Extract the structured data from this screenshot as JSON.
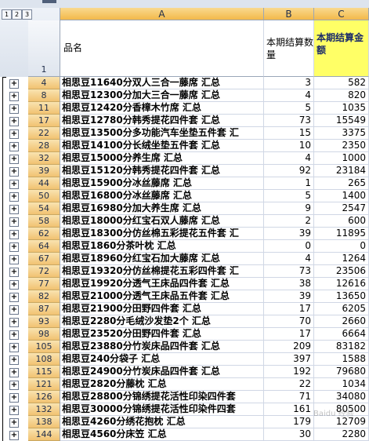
{
  "outline_levels": [
    "1",
    "2",
    "3"
  ],
  "columns": [
    "A",
    "B",
    "C"
  ],
  "header_row_number": "1",
  "header": {
    "name": "品名",
    "qty": "本期结算数量",
    "amount": "本期结算金额"
  },
  "rows": [
    {
      "num": "4",
      "name": "相思豆11640分双人三合一藤席 汇总",
      "qty": "3",
      "amount": "582"
    },
    {
      "num": "8",
      "name": "相思豆12300分加大三合一藤席 汇总",
      "qty": "4",
      "amount": "820"
    },
    {
      "num": "11",
      "name": "相思豆12420分香樟木竹席 汇总",
      "qty": "5",
      "amount": "1035"
    },
    {
      "num": "17",
      "name": "相思豆12780分韩秀提花四件套 汇总",
      "qty": "73",
      "amount": "15549"
    },
    {
      "num": "22",
      "name": "相思豆13500分多功能汽车坐垫五件套 汇",
      "qty": "15",
      "amount": "3375"
    },
    {
      "num": "28",
      "name": "相思豆14100分长绒坐垫五件套 汇总",
      "qty": "10",
      "amount": "2350"
    },
    {
      "num": "32",
      "name": "相思豆15000分养生席 汇总",
      "qty": "4",
      "amount": "1000"
    },
    {
      "num": "39",
      "name": "相思豆15120分韩秀提花四件套 汇总",
      "qty": "92",
      "amount": "23184"
    },
    {
      "num": "44",
      "name": "相思豆15900分冰丝藤席 汇总",
      "qty": "1",
      "amount": "265"
    },
    {
      "num": "50",
      "name": "相思豆16800分冰丝藤席 汇总",
      "qty": "5",
      "amount": "1400"
    },
    {
      "num": "54",
      "name": "相思豆16980分加大养生席 汇总",
      "qty": "9",
      "amount": "2547"
    },
    {
      "num": "58",
      "name": "相思豆18000分红宝石双人藤席 汇总",
      "qty": "2",
      "amount": "600"
    },
    {
      "num": "62",
      "name": "相思豆18300分仿丝棉五彩提花五件套 汇",
      "qty": "39",
      "amount": "11895"
    },
    {
      "num": "64",
      "name": "相思豆1860分茶叶枕 汇总",
      "qty": "0",
      "amount": "0"
    },
    {
      "num": "67",
      "name": "相思豆18960分红宝石加大藤席 汇总",
      "qty": "4",
      "amount": "1264"
    },
    {
      "num": "72",
      "name": "相思豆19320分仿丝棉提花五彩四件套 汇",
      "qty": "73",
      "amount": "23506"
    },
    {
      "num": "77",
      "name": "相思豆19920分透气王床品四件套 汇总",
      "qty": "38",
      "amount": "12616"
    },
    {
      "num": "82",
      "name": "相思豆21000分透气王床品五件套 汇总",
      "qty": "39",
      "amount": "13650"
    },
    {
      "num": "87",
      "name": "相思豆21900分田野四件套 汇总",
      "qty": "17",
      "amount": "6205"
    },
    {
      "num": "93",
      "name": "相思豆2280分毛绒沙发垫2个 汇总",
      "qty": "70",
      "amount": "2660"
    },
    {
      "num": "98",
      "name": "相思豆23520分田野四件套 汇总",
      "qty": "17",
      "amount": "6664"
    },
    {
      "num": "105",
      "name": "相思豆23880分竹炭床品四件套 汇总",
      "qty": "209",
      "amount": "83182"
    },
    {
      "num": "108",
      "name": "相思豆240分袋子 汇总",
      "qty": "397",
      "amount": "1588"
    },
    {
      "num": "115",
      "name": "相思豆24900分竹炭床品四件套 汇总",
      "qty": "192",
      "amount": "79680"
    },
    {
      "num": "121",
      "name": "相思豆2820分藤枕 汇总",
      "qty": "22",
      "amount": "1034"
    },
    {
      "num": "126",
      "name": "相思豆28800分锦绣提花活性印染四件套",
      "qty": "71",
      "amount": "34080"
    },
    {
      "num": "132",
      "name": "相思豆30000分锦绣提花活性印染件四套",
      "qty": "161",
      "amount": "80500"
    },
    {
      "num": "138",
      "name": "相思豆4260分绣花抱枕 汇总",
      "qty": "179",
      "amount": "12709"
    },
    {
      "num": "144",
      "name": "相思豆4560分床笠 汇总",
      "qty": "30",
      "amount": "2280"
    }
  ],
  "watermark": "Baidu 经验"
}
